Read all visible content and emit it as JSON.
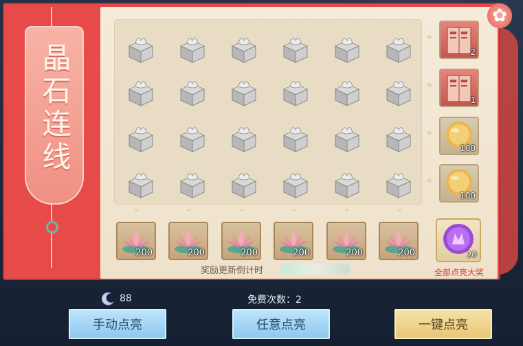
{
  "title": "晶石连线",
  "grid": {
    "rows": 4,
    "cols": 6,
    "item_icon": "silver-gift-box-icon"
  },
  "row_rewards": [
    {
      "icon": "book-icon",
      "qty": "2"
    },
    {
      "icon": "book-icon",
      "qty": "1"
    },
    {
      "icon": "gold-coin-icon",
      "qty": "100"
    },
    {
      "icon": "gold-coin-icon",
      "qty": "100"
    }
  ],
  "column_rewards": [
    {
      "icon": "lotus-icon",
      "qty": "200"
    },
    {
      "icon": "lotus-icon",
      "qty": "200"
    },
    {
      "icon": "lotus-icon",
      "qty": "200"
    },
    {
      "icon": "lotus-icon",
      "qty": "200"
    },
    {
      "icon": "lotus-icon",
      "qty": "200"
    },
    {
      "icon": "lotus-icon",
      "qty": "200"
    }
  ],
  "grand_prize": {
    "icon": "purple-orb-icon",
    "qty": "20",
    "label": "全部点亮大奖"
  },
  "countdown_label": "奖励更新倒计时",
  "currency": {
    "icon": "crescent-gem-icon",
    "amount": "88"
  },
  "free_count": "免费次数：2",
  "buttons": {
    "manual": "手动点亮",
    "random": "任意点亮",
    "all": "一键点亮"
  },
  "colors": {
    "panel_red": "#e64b4a",
    "paper": "#f5ebda",
    "blue_button": "#a7d6f5",
    "gold_button": "#efd48f",
    "grand_label": "#d9423d"
  }
}
